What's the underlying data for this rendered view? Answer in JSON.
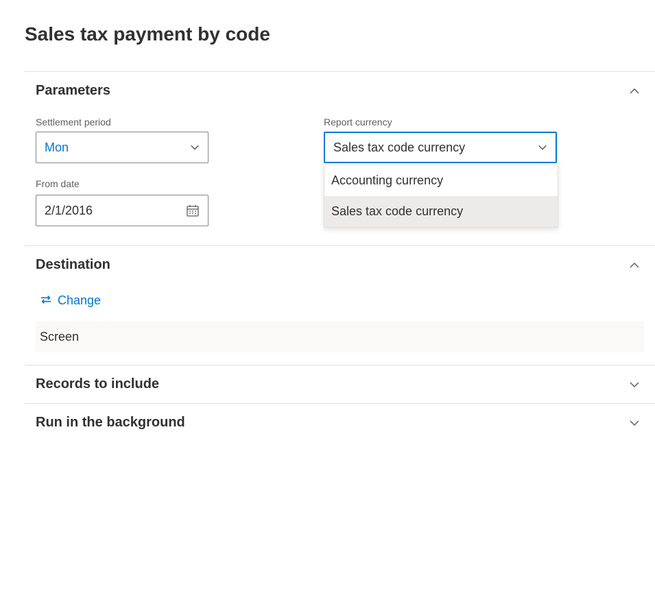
{
  "page_title": "Sales tax payment by code",
  "sections": {
    "parameters": {
      "title": "Parameters",
      "expanded": true
    },
    "destination": {
      "title": "Destination",
      "expanded": true
    },
    "records": {
      "title": "Records to include",
      "expanded": false
    },
    "background": {
      "title": "Run in the background",
      "expanded": false
    }
  },
  "parameters": {
    "settlement_period": {
      "label": "Settlement period",
      "value": "Mon"
    },
    "from_date": {
      "label": "From date",
      "value": "2/1/2016"
    },
    "report_currency": {
      "label": "Report currency",
      "value": "Sales tax code currency",
      "options": [
        "Accounting currency",
        "Sales tax code currency"
      ],
      "selected_index": 1
    }
  },
  "destination": {
    "change_label": "Change",
    "value": "Screen"
  }
}
